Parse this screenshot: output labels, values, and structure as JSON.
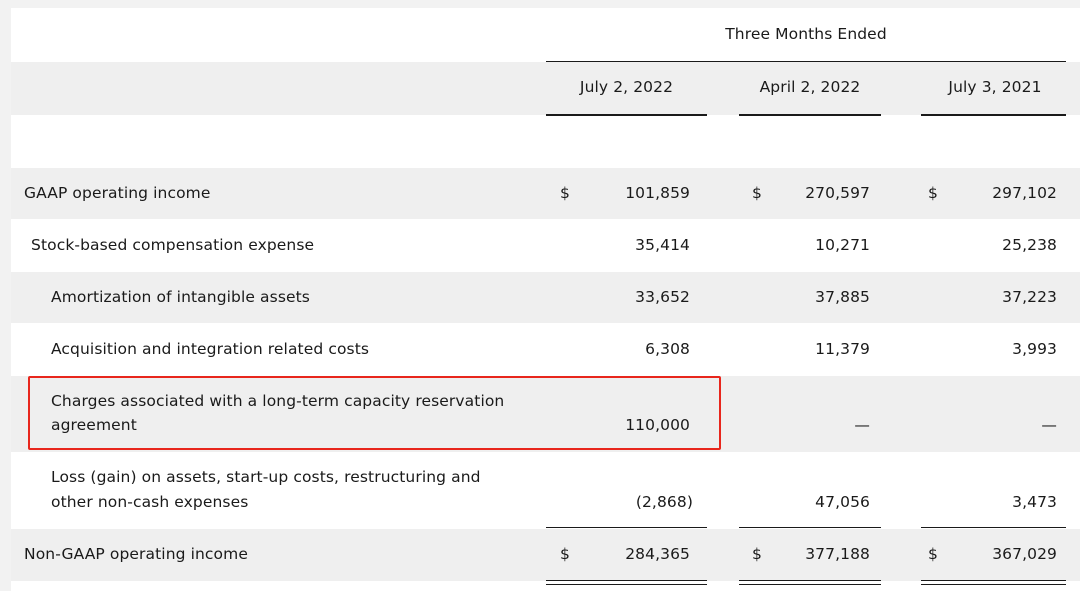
{
  "header": {
    "period_title": "Three Months Ended",
    "columns": [
      "July 2, 2022",
      "April 2, 2022",
      "July 3, 2021"
    ]
  },
  "rows": [
    {
      "label": "GAAP operating income",
      "dollar": "$",
      "values": [
        "101,859",
        "270,597",
        "297,102"
      ]
    },
    {
      "label": "Stock-based compensation expense",
      "values": [
        "35,414",
        "10,271",
        "25,238"
      ]
    },
    {
      "label": "Amortization of intangible assets",
      "values": [
        "33,652",
        "37,885",
        "37,223"
      ]
    },
    {
      "label": "Acquisition and integration related costs",
      "values": [
        "6,308",
        "11,379",
        "3,993"
      ]
    },
    {
      "label_line1": "Charges associated with a long-term capacity reservation",
      "label_line2": "agreement",
      "values": [
        "110,000",
        "—",
        "—"
      ]
    },
    {
      "label_line1": "Loss (gain) on assets, start-up costs, restructuring and",
      "label_line2": "other non-cash expenses",
      "values": [
        "(2,868)",
        "47,056",
        "3,473"
      ]
    },
    {
      "label": "Non-GAAP operating income",
      "dollar": "$",
      "values": [
        "284,365",
        "377,188",
        "367,029"
      ]
    }
  ],
  "colors": {
    "highlight_border": "#e8261c",
    "row_shade": "#efefef"
  }
}
